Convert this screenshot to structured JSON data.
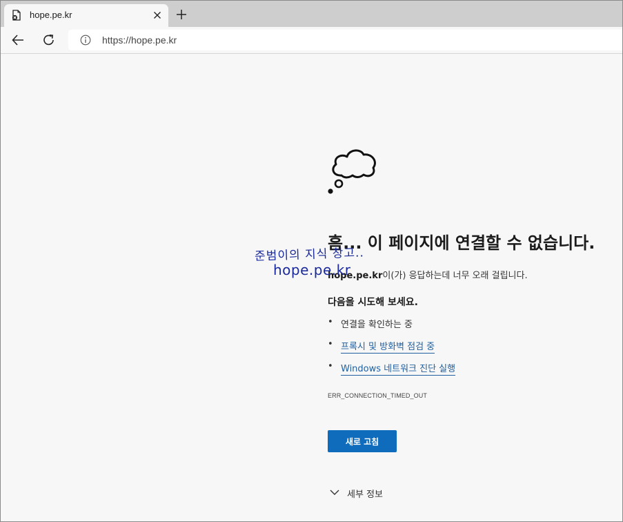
{
  "browser": {
    "tab": {
      "title": "hope.pe.kr",
      "favicon": "broken-page-icon",
      "close_icon": "close-icon"
    },
    "new_tab_icon": "plus-icon",
    "toolbar": {
      "back_icon": "arrow-left-icon",
      "reload_icon": "reload-icon",
      "site_info_icon": "info-icon",
      "url": "https://hope.pe.kr"
    }
  },
  "error_page": {
    "illustration": "thought-cloud-icon",
    "heading": "흠... 이 페이지에 연결할 수 없습니다.",
    "host": "hope.pe.kr",
    "description_suffix": "이(가) 응답하는데 너무 오래 걸립니다.",
    "try_heading": "다음을 시도해 보세요.",
    "suggestions": [
      {
        "text": "연결을 확인하는 중",
        "link": false
      },
      {
        "text": "프록시 및 방화벽 점검 중",
        "link": true
      },
      {
        "text": "Windows 네트워크 진단 실행",
        "link": true
      }
    ],
    "error_code": "ERR_CONNECTION_TIMED_OUT",
    "refresh_button": "새로 고침",
    "details_label": "세부 정보",
    "accent_color": "#0f6cbd",
    "link_color": "#1f5fa0"
  },
  "watermark": {
    "line1": "준범이의 지식 창고..",
    "line2": "hope.pe.kr",
    "color": "#1a2a9c"
  }
}
